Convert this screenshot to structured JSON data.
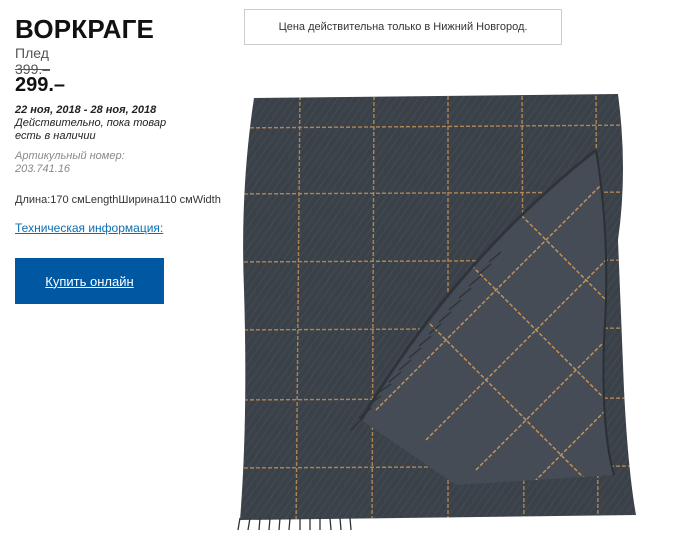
{
  "product": {
    "name": "ВОРКРАГЕ",
    "type": "Плед",
    "old_price": "399.–",
    "price": "299.–",
    "validity_dates": "22 ноя, 2018 - 28 ноя, 2018",
    "validity_text": "Действительно, пока товар есть в наличии",
    "article_label": "Артикульный номер:",
    "article_number": "203.741.16",
    "dimensions": "Длина:170 смLengthШирина110 смWidth",
    "tech_info_link": "Техническая информация:",
    "buy_button": "Купить онлайн"
  },
  "notice": {
    "text": "Цена действительна только в Нижний Новгород."
  },
  "colors": {
    "accent": "#0058a3",
    "link": "#0a6fb3",
    "fabric": "#3f454d",
    "check_lines": "#c9955a"
  },
  "image": {
    "icon": "folded-checked-throw-image"
  }
}
